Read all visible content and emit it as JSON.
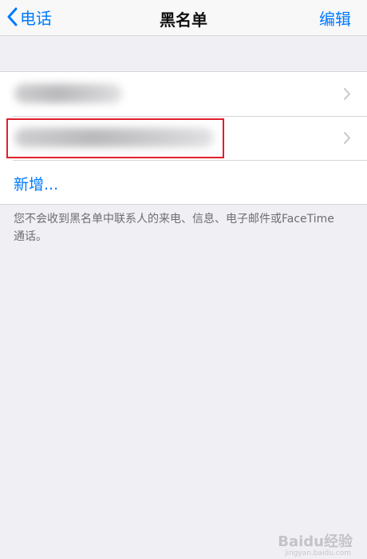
{
  "navbar": {
    "back_label": "电话",
    "title": "黑名单",
    "edit_label": "编辑"
  },
  "blocked_list": {
    "items": [
      {
        "label": "",
        "blurred": true
      },
      {
        "label": "",
        "blurred": true,
        "highlighted": true
      }
    ],
    "add_label": "新增..."
  },
  "footer": {
    "note": "您不会收到黑名单中联系人的来电、信息、电子邮件或FaceTime 通话。"
  },
  "watermark": {
    "brand": "Baidu经验",
    "sub": "jingyan.baidu.com"
  },
  "colors": {
    "accent": "#007aff",
    "background": "#efeff4",
    "highlight": "#e0202c"
  }
}
